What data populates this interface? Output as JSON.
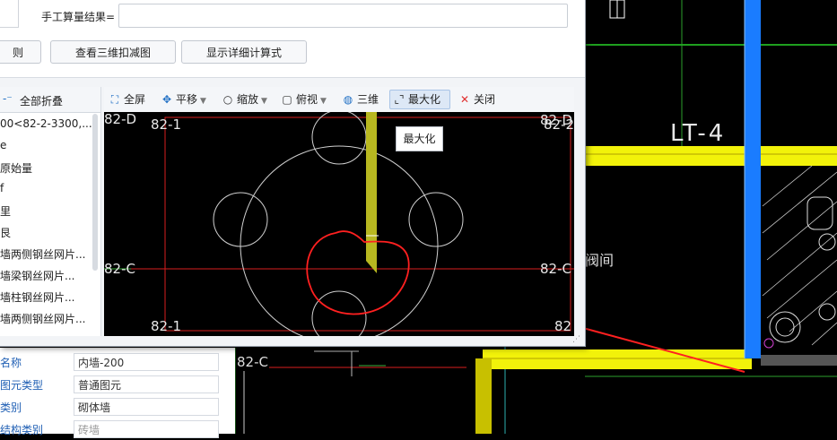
{
  "top": {
    "manual_label": "手工算量结果=",
    "manual_value": "",
    "btn_rule": "则",
    "btn_3d_deduct": "查看三维扣减图",
    "btn_show_formula": "显示详细计算式"
  },
  "tree": {
    "collapse_all": "全部折叠",
    "items": [
      "00<82-2-3300,...",
      "e",
      "原始量",
      "f",
      "里",
      "艮",
      "墙两侧钢丝网片...",
      "墙梁钢丝网片...",
      "墙柱钢丝网片...",
      "墙两侧钢丝网片..."
    ]
  },
  "toolbar": {
    "fullscreen": "全屏",
    "pan": "平移",
    "zoom": "缩放",
    "top_view": "俯视",
    "three_d": "三维",
    "maximize": "最大化",
    "close": "关闭"
  },
  "tooltip": "最大化",
  "viewer_labels": {
    "tl_axis": "82-D",
    "tr_axis": "82-D",
    "top_left_grid": "82-1",
    "top_right_grid": "82-2",
    "left_mid": "82-C",
    "right_mid": "82-C",
    "bottom_left_grid": "82-1",
    "bottom_right_grid": "82"
  },
  "cad_labels": {
    "lt4": "LT-4",
    "valve_room": "阀间",
    "bottom_axis": "82-C"
  },
  "properties": [
    {
      "name": "名称",
      "value": "内墙-200"
    },
    {
      "name": "图元类型",
      "value": "普通图元"
    },
    {
      "name": "类别",
      "value": "砌体墙"
    },
    {
      "name": "结构类别",
      "value": "砖墙"
    }
  ],
  "colors": {
    "accent": "#1f6fc4",
    "wall_yellow": "#f2f20a",
    "axis_red": "#d81e1e",
    "annotation_red": "#ff2020",
    "blue_column": "#1a7cff"
  }
}
